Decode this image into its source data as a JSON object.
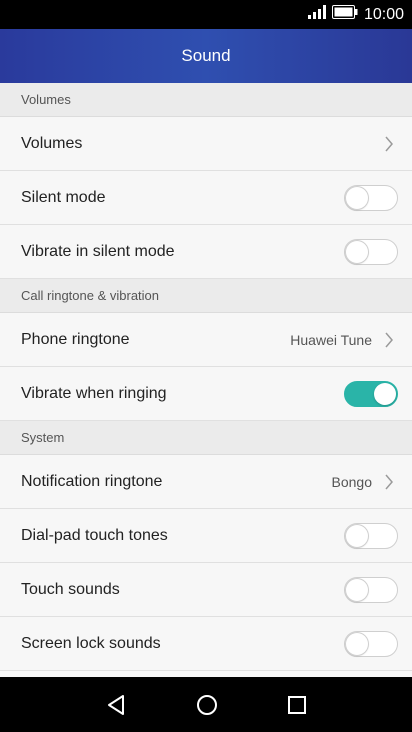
{
  "status_bar": {
    "time": "10:00"
  },
  "header": {
    "title": "Sound"
  },
  "sections": {
    "volumes": {
      "header": "Volumes"
    },
    "call": {
      "header": "Call ringtone & vibration"
    },
    "system": {
      "header": "System"
    }
  },
  "rows": {
    "volumes": {
      "label": "Volumes"
    },
    "silent_mode": {
      "label": "Silent mode",
      "on": false
    },
    "vibrate_silent": {
      "label": "Vibrate in silent mode",
      "on": false
    },
    "phone_ringtone": {
      "label": "Phone ringtone",
      "value": "Huawei Tune"
    },
    "vibrate_ringing": {
      "label": "Vibrate when ringing",
      "on": true
    },
    "notification_ringtone": {
      "label": "Notification ringtone",
      "value": "Bongo"
    },
    "dialpad_tones": {
      "label": "Dial-pad touch tones",
      "on": false
    },
    "touch_sounds": {
      "label": "Touch sounds",
      "on": false
    },
    "screen_lock_sounds": {
      "label": "Screen lock sounds",
      "on": false
    }
  },
  "colors": {
    "accent": "#2ab4a8",
    "header_bg": "#2f4fb0"
  },
  "icons": {
    "signal": "signal-icon",
    "battery": "battery-icon",
    "back": "back-icon",
    "home": "home-icon",
    "recents": "recents-icon",
    "chevron": "chevron-right-icon"
  }
}
